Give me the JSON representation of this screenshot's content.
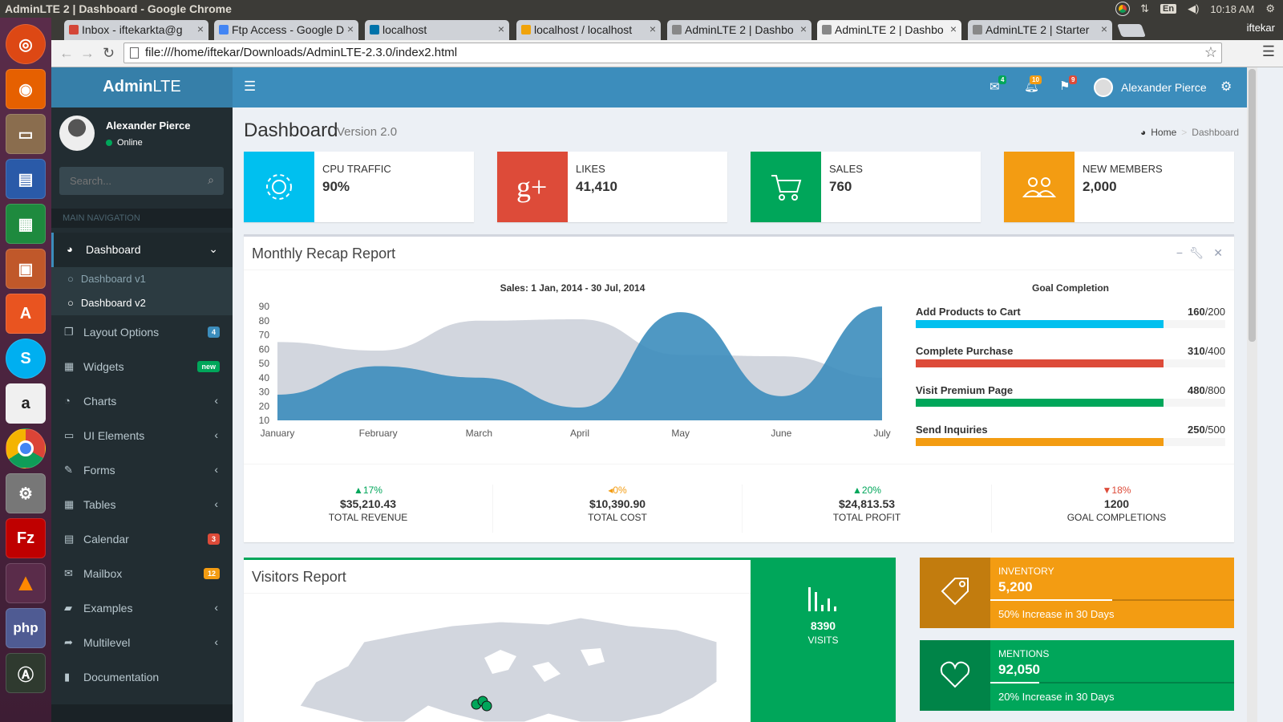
{
  "os": {
    "window_title": "AdminLTE 2 | Dashboard - Google Chrome",
    "lang": "En",
    "time": "10:18 AM"
  },
  "browser": {
    "tabs": [
      {
        "title": "Inbox - iftekarkta@g",
        "color": "#d44638"
      },
      {
        "title": "Ftp Access - Google D",
        "color": "#4285f4"
      },
      {
        "title": "localhost",
        "color": "#0073aa"
      },
      {
        "title": "localhost / localhost",
        "color": "#f0a30a"
      },
      {
        "title": "AdminLTE 2 | Dashbo",
        "color": "#888"
      },
      {
        "title": "AdminLTE 2 | Dashbo",
        "color": "#888"
      },
      {
        "title": "AdminLTE 2 | Starter",
        "color": "#888"
      }
    ],
    "user": "iftekar",
    "url": "file:///home/iftekar/Downloads/AdminLTE-2.3.0/index2.html"
  },
  "header": {
    "logo_bold": "Admin",
    "logo_light": "LTE",
    "messages_count": "4",
    "notifications_count": "10",
    "tasks_count": "9",
    "user_name": "Alexander Pierce"
  },
  "sidebar": {
    "user_name": "Alexander Pierce",
    "status": "Online",
    "search_placeholder": "Search...",
    "nav_header": "MAIN NAVIGATION",
    "dashboard": "Dashboard",
    "sub_v1": "Dashboard v1",
    "sub_v2": "Dashboard v2",
    "items": [
      {
        "label": "Layout Options",
        "icon": "files-icon",
        "glyph": "❐",
        "badge": "4",
        "badge_color": "#3c8dbc"
      },
      {
        "label": "Widgets",
        "icon": "th-icon",
        "glyph": "▦",
        "badge": "new",
        "badge_color": "#00a65a"
      },
      {
        "label": "Charts",
        "icon": "pie-chart-icon",
        "glyph": "◔",
        "badge": "",
        "badge_color": ""
      },
      {
        "label": "UI Elements",
        "icon": "laptop-icon",
        "glyph": "▭",
        "badge": "",
        "badge_color": ""
      },
      {
        "label": "Forms",
        "icon": "edit-icon",
        "glyph": "✎",
        "badge": "",
        "badge_color": ""
      },
      {
        "label": "Tables",
        "icon": "table-icon",
        "glyph": "▦",
        "badge": "",
        "badge_color": ""
      },
      {
        "label": "Calendar",
        "icon": "calendar-icon",
        "glyph": "▤",
        "badge": "3",
        "badge_color": "#dd4b39"
      },
      {
        "label": "Mailbox",
        "icon": "envelope-icon",
        "glyph": "✉",
        "badge": "12",
        "badge_color": "#f39c12"
      },
      {
        "label": "Examples",
        "icon": "folder-icon",
        "glyph": "▰",
        "badge": "",
        "badge_color": ""
      },
      {
        "label": "Multilevel",
        "icon": "share-icon",
        "glyph": "➦",
        "badge": "",
        "badge_color": ""
      },
      {
        "label": "Documentation",
        "icon": "book-icon",
        "glyph": "▮",
        "badge": "",
        "badge_color": ""
      }
    ]
  },
  "page": {
    "title": "Dashboard",
    "subtitle": "Version 2.0",
    "crumb_home": "Home",
    "crumb_current": "Dashboard"
  },
  "info_boxes": [
    {
      "label": "CPU TRAFFIC",
      "value": "90%",
      "color": "#00c0ef",
      "icon": "gear-icon"
    },
    {
      "label": "LIKES",
      "value": "41,410",
      "color": "#dd4b39",
      "icon": "google-plus-icon"
    },
    {
      "label": "SALES",
      "value": "760",
      "color": "#00a65a",
      "icon": "shopping-cart-icon"
    },
    {
      "label": "NEW MEMBERS",
      "value": "2,000",
      "color": "#f39c12",
      "icon": "users-icon"
    }
  ],
  "recap": {
    "title": "Monthly Recap Report",
    "goal_title": "Goal Completion",
    "goals": [
      {
        "label": "Add Products to Cart",
        "done": "160",
        "total": "/200",
        "pct": 80,
        "color": "#00c0ef"
      },
      {
        "label": "Complete Purchase",
        "done": "310",
        "total": "/400",
        "pct": 80,
        "color": "#dd4b39"
      },
      {
        "label": "Visit Premium Page",
        "done": "480",
        "total": "/800",
        "pct": 80,
        "color": "#00a65a"
      },
      {
        "label": "Send Inquiries",
        "done": "250",
        "total": "/500",
        "pct": 80,
        "color": "#f39c12"
      }
    ],
    "stats": [
      {
        "arrow": "▲",
        "pct": "17%",
        "amount": "$35,210.43",
        "label": "TOTAL REVENUE",
        "color": "#00a65a"
      },
      {
        "arrow": "◂",
        "pct": "0%",
        "amount": "$10,390.90",
        "label": "TOTAL COST",
        "color": "#f39c12"
      },
      {
        "arrow": "▲",
        "pct": "20%",
        "amount": "$24,813.53",
        "label": "TOTAL PROFIT",
        "color": "#00a65a"
      },
      {
        "arrow": "▼",
        "pct": "18%",
        "amount": "1200",
        "label": "GOAL COMPLETIONS",
        "color": "#dd4b39"
      }
    ]
  },
  "chart_data": {
    "type": "area",
    "title": "Sales: 1 Jan, 2014 - 30 Jul, 2014",
    "categories": [
      "January",
      "February",
      "March",
      "April",
      "May",
      "June",
      "July"
    ],
    "ylim": [
      10,
      90
    ],
    "yticks": [
      10,
      20,
      30,
      40,
      50,
      60,
      70,
      80,
      90
    ],
    "series": [
      {
        "values": [
          65,
          59,
          80,
          81,
          56,
          55,
          40
        ],
        "color": "#d2d6de"
      },
      {
        "values": [
          28,
          48,
          40,
          19,
          86,
          27,
          90
        ],
        "color": "#3c8dbc"
      }
    ]
  },
  "visitors": {
    "title": "Visitors Report",
    "visits": "8390",
    "visits_label": "VISITS"
  },
  "side_boxes": [
    {
      "label": "INVENTORY",
      "value": "5,200",
      "desc": "50% Increase in 30 Days",
      "pct": 50,
      "color": "#f39c12",
      "icon": "tag-icon"
    },
    {
      "label": "MENTIONS",
      "value": "92,050",
      "desc": "20% Increase in 30 Days",
      "pct": 20,
      "color": "#00a65a",
      "icon": "heart-icon"
    }
  ]
}
